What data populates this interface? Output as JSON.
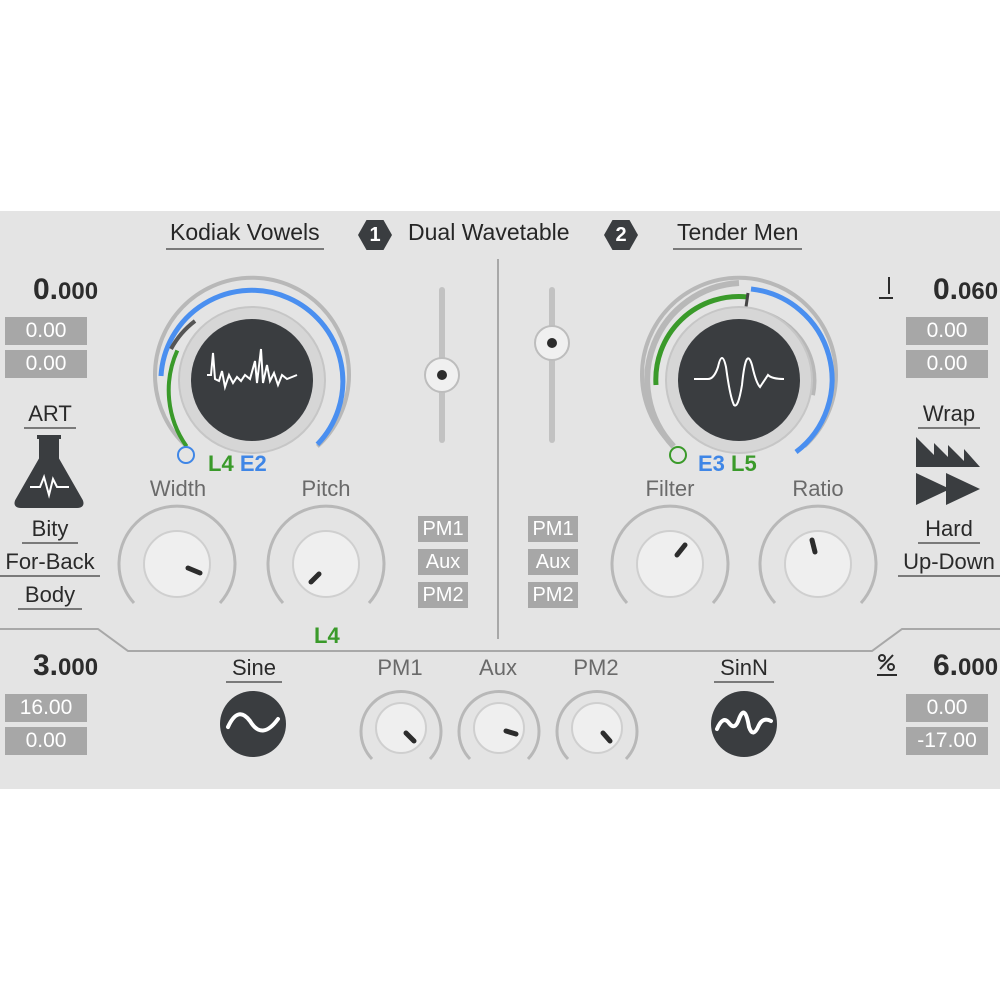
{
  "header": {
    "osc1_preset": "Kodiak Vowels",
    "osc1_number": "1",
    "mode": "Dual Wavetable",
    "osc2_number": "2",
    "osc2_preset": "Tender Men"
  },
  "left_panel": {
    "value_int": "0.",
    "value_dec": "000",
    "box1": "0.00",
    "box2": "0.00",
    "art_label": "ART",
    "art_icon": "flask-icon",
    "mode1": "Bity",
    "mode2": "For-Back",
    "mode3": "Body"
  },
  "right_panel": {
    "note_icon": "note-icon",
    "value_int": "0.",
    "value_dec": "060",
    "box1": "0.00",
    "box2": "0.00",
    "wrap_label": "Wrap",
    "wrap_icon": "wrap-icon",
    "mode1": "Hard",
    "mode2": "Up-Down"
  },
  "osc1": {
    "tags": {
      "l": "L4",
      "e": "E2"
    },
    "knob1_label": "Width",
    "knob2_label": "Pitch",
    "pitch_tag": "L4",
    "mod_tags": [
      "PM1",
      "Aux",
      "PM2"
    ],
    "slider_level": 0.45
  },
  "osc2": {
    "tags": {
      "e": "E3",
      "l": "L5"
    },
    "knob1_label": "Filter",
    "knob2_label": "Ratio",
    "mod_tags": [
      "PM1",
      "Aux",
      "PM2"
    ],
    "slider_level": 0.85
  },
  "bottom": {
    "left_value_int": "3.",
    "left_value_dec": "000",
    "left_box1": "16.00",
    "left_box2": "0.00",
    "wave1_label": "Sine",
    "wave1_icon": "sine-wave-icon",
    "knob_labels": [
      "PM1",
      "Aux",
      "PM2"
    ],
    "wave2_label": "SinN",
    "wave2_icon": "sinn-wave-icon",
    "percent_icon": "percent-icon",
    "right_value_int": "6.",
    "right_value_dec": "000",
    "right_box1": "0.00",
    "right_box2": "-17.00"
  },
  "colors": {
    "panel": "#e4e4e4",
    "accent_blue": "#3f86e6",
    "accent_green": "#3a9a2a",
    "display": "#3a3d40",
    "value_box": "#a7a7a7"
  }
}
